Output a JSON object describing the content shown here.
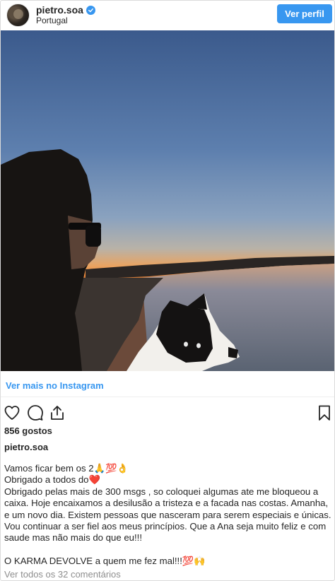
{
  "header": {
    "username": "pietro.soa",
    "location": "Portugal",
    "view_profile_label": "Ver perfil"
  },
  "post": {
    "view_more_label": "Ver mais no Instagram",
    "likes_text": "856 gostos",
    "caption_username": "pietro.soa",
    "caption_lines": [
      "Vamos ficar bem os 2🙏💯👌",
      "Obrigado a todos do❤️",
      "Obrigado pelas mais de 300 msgs , so coloquei algumas ate me bloqueou a caixa. Hoje encaixamos a desilusão a tristeza e a facada nas costas. Amanha, e um novo dia. Existem pessoas que nasceram para serem especiais e únicas. Vou continuar a ser fiel aos meus princípios. Que a Ana seja muito feliz e com saude mas não mais do que eu!!!",
      "",
      "O KARMA DEVOLVE a quem me fez mal!!!💯🙌"
    ],
    "comments_link": "Ver todos os 32 comentários"
  },
  "icons": {
    "verified": "verified-badge-icon",
    "like": "heart-icon",
    "comment": "comment-icon",
    "share": "share-icon",
    "save": "bookmark-icon"
  },
  "colors": {
    "accent": "#3897f0",
    "text": "#262626",
    "muted": "#8e8e8e"
  }
}
